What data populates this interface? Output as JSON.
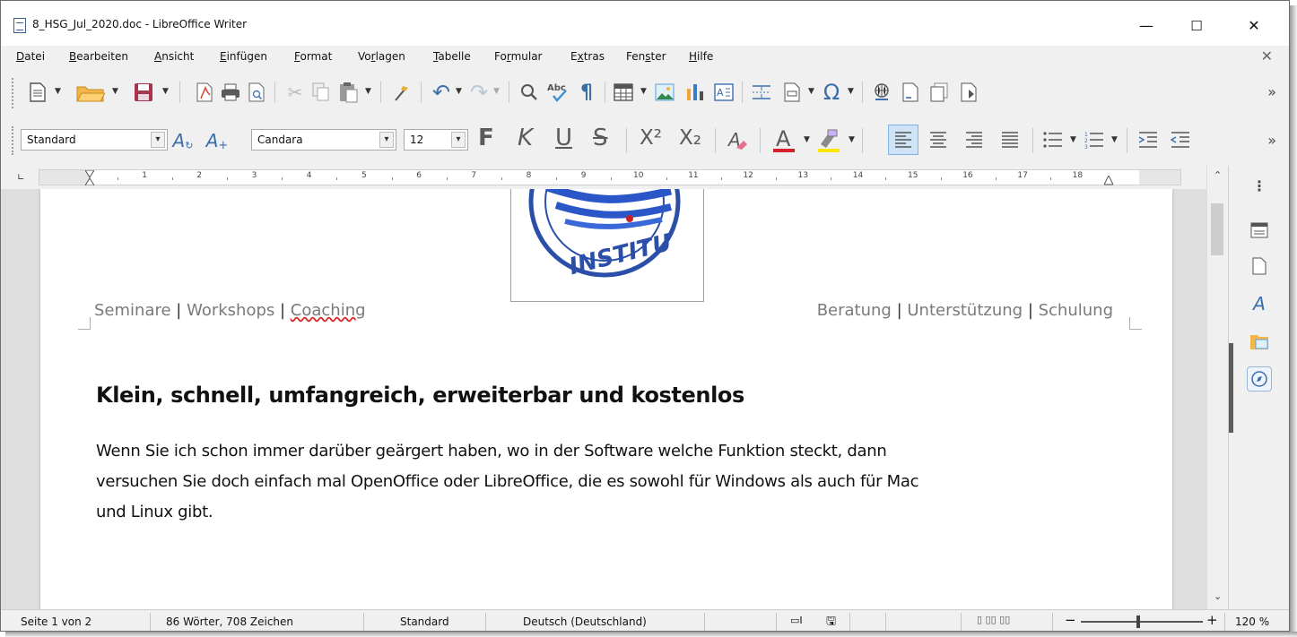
{
  "window": {
    "title": "8_HSG_Jul_2020.doc - LibreOffice Writer",
    "controls": {
      "minimize": "—",
      "maximize": "☐",
      "close": "✕"
    }
  },
  "menubar": {
    "items": [
      {
        "accel": "D",
        "rest": "atei"
      },
      {
        "accel": "B",
        "rest": "earbeiten"
      },
      {
        "accel": "A",
        "rest": "nsicht"
      },
      {
        "accel": "E",
        "rest": "infügen"
      },
      {
        "accel": "F",
        "rest": "ormat"
      },
      {
        "accel": "V",
        "pre": "Vo",
        "accel2": "r",
        "rest": "lagen"
      },
      {
        "accel": "T",
        "rest": "abelle"
      },
      {
        "pre": "Fo",
        "accel2": "r",
        "rest": "mular"
      },
      {
        "pre": "E",
        "accel2": "x",
        "rest": "tras"
      },
      {
        "pre": "Fen",
        "accel2": "s",
        "rest": "ter"
      },
      {
        "accel": "H",
        "rest": "ilfe"
      }
    ],
    "close_document": "✕"
  },
  "formatting": {
    "paragraph_style": "Standard",
    "font_name": "Candara",
    "font_size": "12",
    "bold": "F",
    "italic": "K",
    "underline": "U",
    "strikethrough": "S",
    "superscript": "X²",
    "subscript": "X₂",
    "more": "»"
  },
  "toolbar": {
    "more": "»"
  },
  "ruler": {
    "numbers": [
      "1",
      "2",
      "3",
      "4",
      "5",
      "6",
      "7",
      "8",
      "9",
      "10",
      "11",
      "12",
      "13",
      "14",
      "15",
      "16",
      "17",
      "18"
    ]
  },
  "document": {
    "header_left": {
      "part1": "Seminare",
      "sep1": " | ",
      "part2": "Workshops ",
      "sep2": " | ",
      "part3": "Coaching"
    },
    "header_right": {
      "part1": "Beratung",
      "sep1": " | ",
      "part2": "Unterstützung",
      "sep2": " | ",
      "part3": "Schulung"
    },
    "logo_text": "INSTITU",
    "heading": "Klein, schnell, umfangreich, erweiterbar und kostenlos",
    "body_lines": [
      "Wenn Sie ich schon immer darüber geärgert haben, wo in der Software welche Funktion steckt, dann",
      "versuchen Sie doch einfach mal OpenOffice oder LibreOffice, die es sowohl für Windows als auch für Mac",
      "und Linux gibt."
    ]
  },
  "statusbar": {
    "page": "Seite 1 von 2",
    "words": "86 Wörter, 708 Zeichen",
    "page_style": "Standard",
    "language": "Deutsch (Deutschland)",
    "zoom_minus": "−",
    "zoom_plus": "+",
    "zoom": "120 %"
  },
  "colors": {
    "font_color_bar": "#d2232a",
    "highlight_bar": "#ffe600",
    "active_button": "#cfe3f7"
  }
}
